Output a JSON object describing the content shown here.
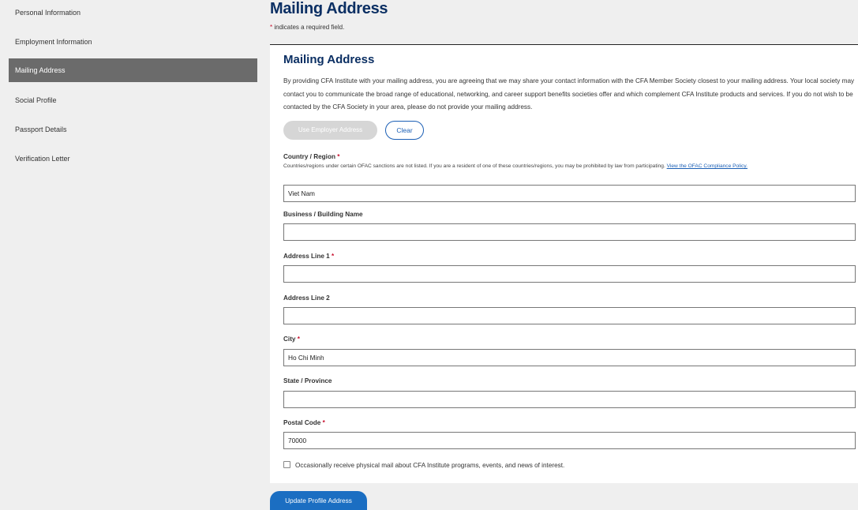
{
  "sidebar": {
    "items": [
      {
        "label": "Personal Information",
        "active": false
      },
      {
        "label": "Employment Information",
        "active": false
      },
      {
        "label": "Mailing Address",
        "active": true
      },
      {
        "label": "Social Profile",
        "active": false
      },
      {
        "label": "Passport Details",
        "active": false
      },
      {
        "label": "Verification Letter",
        "active": false
      }
    ]
  },
  "header": {
    "title": "Mailing Address",
    "required_star": "*",
    "required_note": " indicates a required field."
  },
  "card": {
    "title": "Mailing Address",
    "description": "By providing CFA Institute with your mailing address, you are agreeing that we may share your contact information with the CFA Member Society closest to your mailing address. Your local society may contact you to communicate the broad range of educational, networking, and career support benefits societies offer and which complement CFA Institute products and services. If you do not wish to be contacted by the CFA Society in your area, please do not provide your mailing address.",
    "use_employer_label": "Use Employer Address",
    "clear_label": "Clear"
  },
  "form": {
    "country": {
      "label": "Country / Region",
      "required": "*",
      "help": "Countries/regions under certain OFAC sanctions are not listed. If you are a resident of one of these countries/regions, you may be prohibited by law from participating. ",
      "help_link": "View the OFAC Compliance Policy.",
      "value": "Viet Nam"
    },
    "business": {
      "label": "Business / Building Name",
      "value": ""
    },
    "address1": {
      "label": "Address Line 1",
      "required": "*",
      "value": ""
    },
    "address2": {
      "label": "Address Line 2",
      "value": ""
    },
    "city": {
      "label": "City",
      "required": "*",
      "value": "Ho Chi Minh"
    },
    "state": {
      "label": "State / Province",
      "value": ""
    },
    "postal": {
      "label": "Postal Code",
      "required": "*",
      "value": "70000"
    },
    "mail_optin": {
      "label": "Occasionally receive physical mail about CFA Institute programs, events, and news of interest.",
      "checked": false
    }
  },
  "footer": {
    "submit_label": "Update Profile Address"
  },
  "colors": {
    "accent": "#1b6ec2",
    "title": "#0b2f63",
    "required": "#c8102e",
    "active_nav": "#6b6b6b"
  }
}
